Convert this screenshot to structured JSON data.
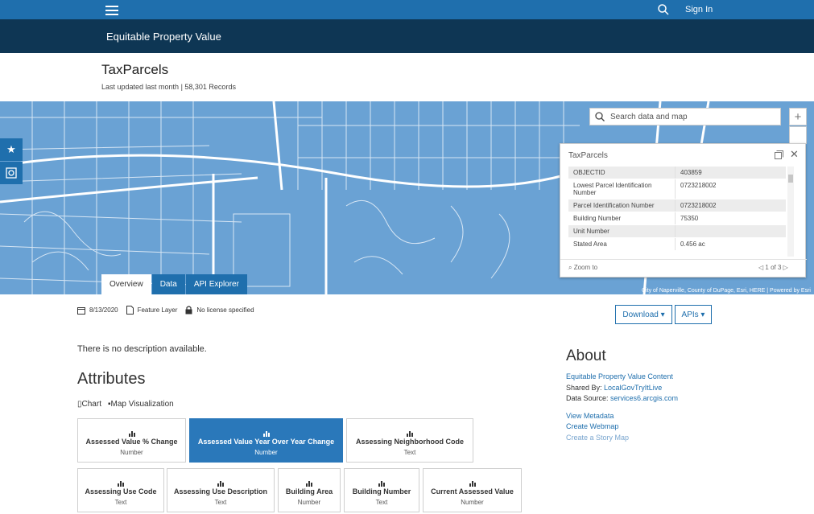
{
  "topbar": {
    "signin_label": "Sign In"
  },
  "site": {
    "title": "Equitable Property Value"
  },
  "dataset": {
    "title": "TaxParcels",
    "meta": "Last updated last month | 58,301 Records"
  },
  "map": {
    "search_placeholder": "Search data and map",
    "attribution": "City of Naperville, County of DuPage, Esri, HERE | Powered by Esri",
    "popup": {
      "title": "TaxParcels",
      "rows": [
        {
          "key": "OBJECTID",
          "value": "403859"
        },
        {
          "key": "Lowest Parcel Identification Number",
          "value": "0723218002"
        },
        {
          "key": "Parcel Identification Number",
          "value": "0723218002"
        },
        {
          "key": "Building Number",
          "value": "75350"
        },
        {
          "key": "Unit Number",
          "value": ""
        },
        {
          "key": "Stated Area",
          "value": "0.456 ac"
        }
      ],
      "zoom_to": "Zoom to",
      "pager": "1 of 3"
    },
    "tabs": [
      "Overview",
      "Data",
      "API Explorer"
    ]
  },
  "meta_row": {
    "date": "8/13/2020",
    "type": "Feature Layer",
    "license": "No license specified"
  },
  "buttons": {
    "download": "Download ▾",
    "apis": "APIs ▾"
  },
  "description": "There is no description available.",
  "attributes": {
    "heading": "Attributes",
    "toggle": [
      "Chart",
      "Map Visualization"
    ],
    "cards": [
      {
        "name": "Assessed Value % Change",
        "type": "Number",
        "selected": false
      },
      {
        "name": "Assessed Value Year Over Year Change",
        "type": "Number",
        "selected": true
      },
      {
        "name": "Assessing Neighborhood Code",
        "type": "Text",
        "selected": false
      },
      {
        "name": "Assessing Use Code",
        "type": "Text",
        "selected": false
      },
      {
        "name": "Assessing Use Description",
        "type": "Text",
        "selected": false
      },
      {
        "name": "Building Area",
        "type": "Number",
        "selected": false
      },
      {
        "name": "Building Number",
        "type": "Text",
        "selected": false
      },
      {
        "name": "Current Assessed Value",
        "type": "Number",
        "selected": false
      }
    ]
  },
  "about": {
    "heading": "About",
    "content_link": "Equitable Property Value Content",
    "shared_by_label": "Shared By: ",
    "shared_by": "LocalGovTryItLive",
    "source_label": "Data Source: ",
    "source": "services6.arcgis.com",
    "view_metadata": "View Metadata",
    "create_webmap": "Create Webmap",
    "create_story_map": "Create a Story Map"
  },
  "colors": {
    "brand": "#1f6fad",
    "header": "#0e3654",
    "map": "#6aa2d4"
  }
}
